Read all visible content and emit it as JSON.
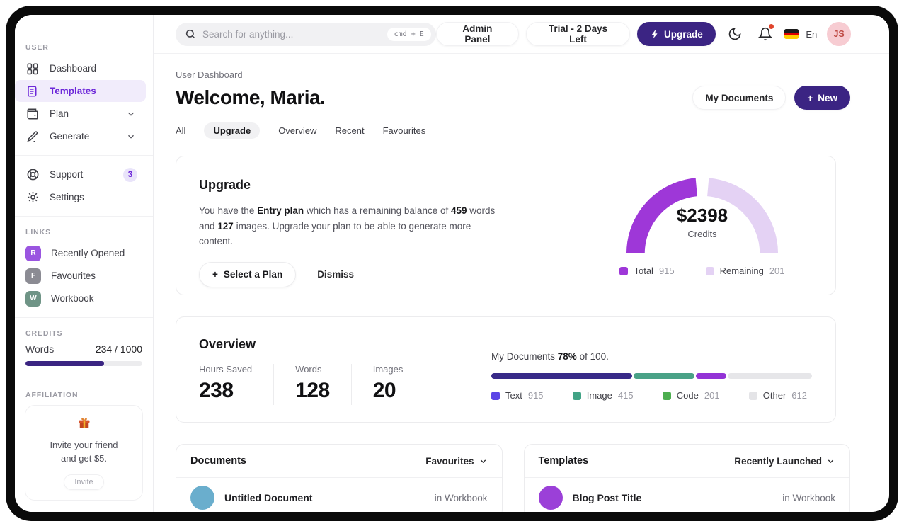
{
  "topbar": {
    "search": {
      "placeholder": "Search for anything...",
      "shortcut": "cmd + E"
    },
    "admin_panel_label": "Admin Panel",
    "trial_label": "Trial - 2 Days Left",
    "upgrade_label": "Upgrade",
    "icons": [
      "bolt-icon",
      "moon-icon",
      "bell-icon",
      "german-flag-icon"
    ],
    "language_label": "En",
    "avatar_initials": "JS",
    "accent_color": "#3b2483"
  },
  "sidebar": {
    "section_user_label": "USER",
    "items": [
      {
        "label": "Dashboard"
      },
      {
        "label": "Templates",
        "active": true
      },
      {
        "label": "Plan"
      },
      {
        "label": "Generate"
      }
    ],
    "support_label": "Support",
    "support_badge": "3",
    "settings_label": "Settings",
    "section_links_label": "LINKS",
    "links": [
      {
        "initial": "R",
        "label": "Recently Opened",
        "color": "#9a55e0"
      },
      {
        "initial": "F",
        "label": "Favourites",
        "color": "#8b8b93"
      },
      {
        "initial": "W",
        "label": "Workbook",
        "color": "#6f9486"
      }
    ],
    "section_credits_label": "CREDITS",
    "credits": {
      "label": "Words",
      "value": "234 / 1000",
      "percent": 67,
      "bar_color": "#3b2582"
    },
    "section_affiliation_label": "AFFILIATION",
    "affiliation": {
      "icon": "gift-icon",
      "line1": "Invite your friend",
      "line2": "and get $5.",
      "button_label": "Invite"
    }
  },
  "header": {
    "breadcrumb": "User Dashboard",
    "title": "Welcome, Maria.",
    "my_documents_label": "My Documents",
    "new_button": {
      "plus": "+",
      "label": "New"
    },
    "tabs": [
      {
        "label": "All"
      },
      {
        "label": "Upgrade",
        "active": true
      },
      {
        "label": "Overview"
      },
      {
        "label": "Recent"
      },
      {
        "label": "Favourites"
      }
    ]
  },
  "upgrade_card": {
    "title": "Upgrade",
    "body": {
      "t1": "You have the ",
      "b1": "Entry plan",
      "t2": " which has a remaining balance of ",
      "b2": "459",
      "t3": " words and ",
      "b3": "127",
      "t4": " images. Upgrade your plan to be able to generate more content."
    },
    "select_plan": {
      "plus": "+",
      "label": "Select a Plan"
    },
    "dismiss_label": "Dismiss",
    "chart": {
      "type": "gauge",
      "center_value": "$2398",
      "center_label": "Credits",
      "series": [
        {
          "label": "Total",
          "value": "915",
          "color": "#9e37d8"
        },
        {
          "label": "Remaining",
          "value": "201",
          "color": "#e4d2f4"
        }
      ]
    }
  },
  "overview_card": {
    "title": "Overview",
    "stats": [
      {
        "label": "Hours Saved",
        "value": "238"
      },
      {
        "label": "Words",
        "value": "128"
      },
      {
        "label": "Images",
        "value": "20"
      }
    ],
    "progress_label": {
      "t1": "My Documents ",
      "pct": "78%",
      "t2": " of 100."
    },
    "chart": {
      "type": "stacked-bar",
      "total_label": "100",
      "segments": [
        {
          "label": "Text",
          "value": "915",
          "width_pct": 44,
          "bar_color": "#382a88",
          "legend_color": "#5b45e6"
        },
        {
          "label": "Image",
          "value": "415",
          "width_pct": 19,
          "bar_color": "#4aa287",
          "legend_color": "#41a385"
        },
        {
          "label": "Code",
          "value": "201",
          "width_pct": 9.5,
          "bar_color": "#9333d6",
          "legend_color": "#4cae4f"
        },
        {
          "label": "Other",
          "value": "612",
          "width_pct": 26.5,
          "bar_color": "#e6e6e9",
          "legend_color": "#e4e4e7"
        }
      ]
    }
  },
  "documents_card": {
    "title": "Documents",
    "filter_label": "Favourites",
    "row": {
      "title": "Untitled Document",
      "location": "in Workbook",
      "avatar_color": "#6aaecd"
    }
  },
  "templates_card": {
    "title": "Templates",
    "filter_label": "Recently Launched",
    "row": {
      "title": "Blog Post Title",
      "location": "in Workbook",
      "avatar_color": "#9b40d8"
    }
  }
}
